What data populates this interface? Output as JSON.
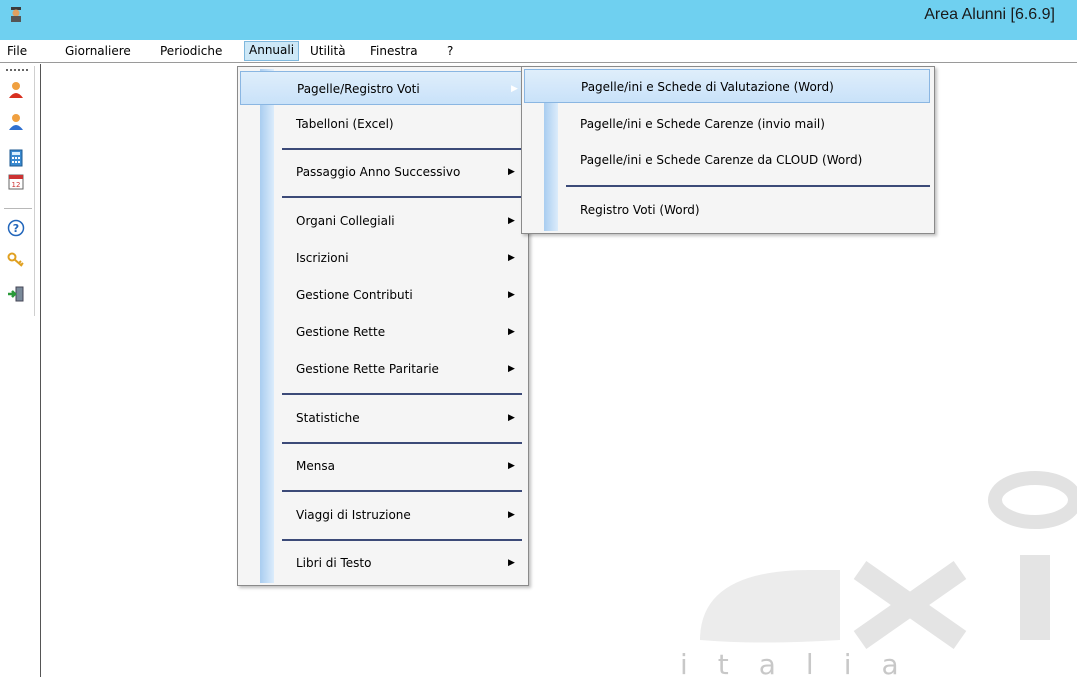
{
  "window": {
    "title": "Area Alunni [6.6.9]",
    "app_icon": "student-app-icon"
  },
  "menubar": {
    "items": [
      {
        "label": "File"
      },
      {
        "label": "Giornaliere"
      },
      {
        "label": "Periodiche"
      },
      {
        "label": "Annuali",
        "open": true
      },
      {
        "label": "Utilità"
      },
      {
        "label": "Finestra"
      },
      {
        "label": "?"
      }
    ]
  },
  "toolbar": {
    "buttons": [
      "user-red-icon",
      "user-blue-icon",
      "calculator-icon",
      "calendar-icon",
      "help-icon",
      "keys-icon",
      "exit-door-icon"
    ]
  },
  "annuali_menu": {
    "items": [
      {
        "label": "Pagelle/Registro Voti",
        "submenu": true,
        "highlighted": true
      },
      {
        "label": "Tabelloni (Excel)",
        "submenu": false
      },
      {
        "label": "Passaggio Anno Successivo",
        "submenu": true
      },
      {
        "label": "Organi Collegiali",
        "submenu": true
      },
      {
        "label": "Iscrizioni",
        "submenu": true
      },
      {
        "label": "Gestione Contributi",
        "submenu": true
      },
      {
        "label": "Gestione Rette",
        "submenu": true
      },
      {
        "label": "Gestione Rette Paritarie",
        "submenu": true
      },
      {
        "label": "Statistiche",
        "submenu": true
      },
      {
        "label": "Mensa",
        "submenu": true
      },
      {
        "label": "Viaggi di Istruzione",
        "submenu": true
      },
      {
        "label": "Libri di Testo",
        "submenu": true
      }
    ]
  },
  "pagelle_submenu": {
    "items": [
      {
        "label": "Pagelle/ini e Schede di Valutazione (Word)",
        "highlighted": true
      },
      {
        "label": "Pagelle/ini e Schede Carenze (invio mail)"
      },
      {
        "label": "Pagelle/ini e Schede Carenze da CLOUD (Word)"
      },
      {
        "label": "Registro Voti (Word)"
      }
    ]
  },
  "watermark": {
    "brand": "axi",
    "sub": "italia"
  }
}
